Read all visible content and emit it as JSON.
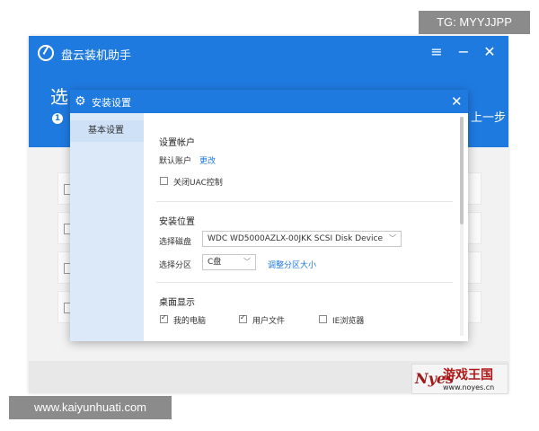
{
  "overlay": {
    "tg_tag": "TG: MYYJJPP",
    "site_url": "www.kaiyunhuati.com",
    "watermark_logo": "Nyes",
    "watermark_name": "游戏王国",
    "watermark_url": "www.noyes.cn"
  },
  "app": {
    "title": "盘云装机助手",
    "icons": {
      "menu": "menu-icon",
      "minimize": "minimize-icon",
      "close": "close-icon"
    },
    "menu_glyph": "≡",
    "minimize_glyph": "−",
    "close_glyph": "✕",
    "banner_heading": "选",
    "banner_step_number": "1",
    "banner_prev": "上一步",
    "accent_color": "#1f7ae0"
  },
  "dialog": {
    "title": "安装设置",
    "close_glyph": "✕",
    "sidebar_items": [
      {
        "label": "基本设置"
      }
    ],
    "account": {
      "section_title": "设置帐户",
      "default_account_label": "默认账户",
      "change_link": "更改",
      "uac_checkbox_label": "关闭UAC控制",
      "uac_checked": false
    },
    "location": {
      "section_title": "安装位置",
      "disk_label": "选择磁盘",
      "disk_value": "WDC WD5000AZLX-00JKK SCSI Disk Device",
      "partition_label": "选择分区",
      "partition_value": "C盘",
      "adjust_link": "调整分区大小"
    },
    "desktop": {
      "section_title": "桌面显示",
      "options": [
        {
          "label": "我的电脑",
          "checked": true
        },
        {
          "label": "用户文件",
          "checked": true
        },
        {
          "label": "IE浏览器",
          "checked": false
        }
      ]
    }
  }
}
